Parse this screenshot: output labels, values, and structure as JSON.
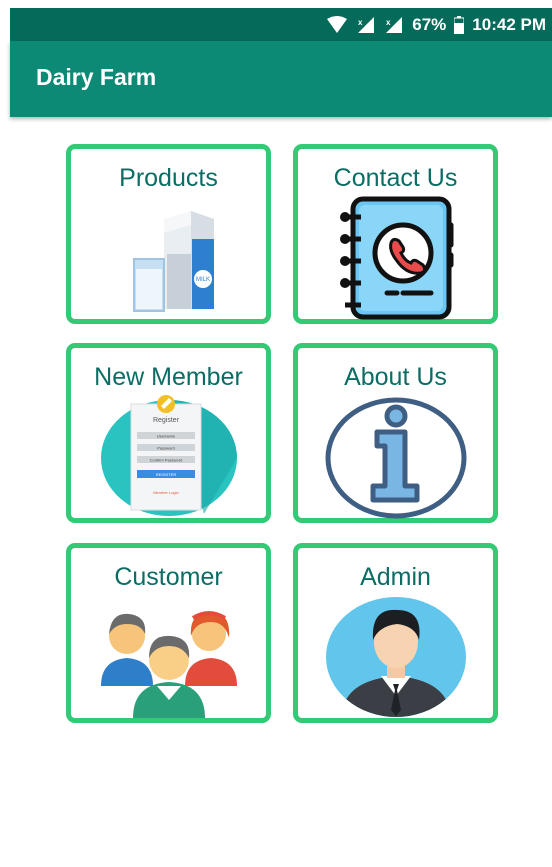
{
  "status_bar": {
    "battery": "67%",
    "time": "10:42 PM",
    "icons": [
      "wifi-icon",
      "signal-icon",
      "signal-icon",
      "battery-icon"
    ]
  },
  "app_bar": {
    "title": "Dairy Farm"
  },
  "menu": [
    {
      "label": "Products",
      "icon": "milk-icon"
    },
    {
      "label": "Contact Us",
      "icon": "contact-book-icon"
    },
    {
      "label": "New Member",
      "icon": "register-form-icon"
    },
    {
      "label": "About Us",
      "icon": "info-icon"
    },
    {
      "label": "Customer",
      "icon": "group-icon"
    },
    {
      "label": "Admin",
      "icon": "businessman-icon"
    }
  ],
  "register_form": {
    "title": "Register",
    "fields": [
      "Username",
      "Password",
      "Confirm Password"
    ],
    "button": "REGISTER",
    "link": "Member Login"
  },
  "milk_carton_label": "MILK",
  "colors": {
    "status_bar": "#046b5a",
    "app_bar": "#0d8a76",
    "card_border": "#34c975",
    "label": "#0b6d64"
  }
}
